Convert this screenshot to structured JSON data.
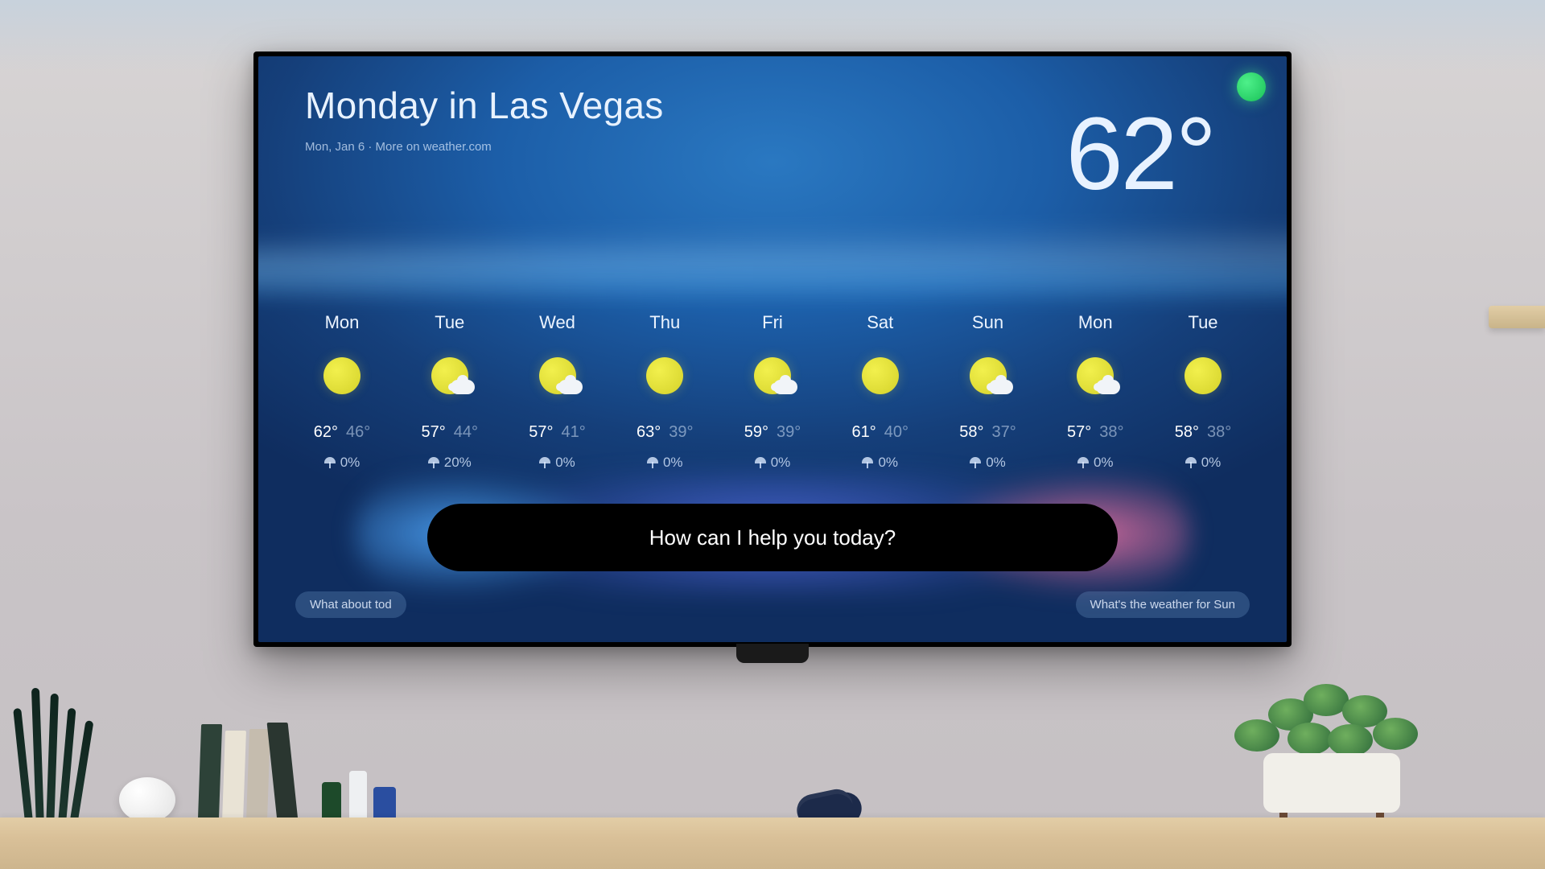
{
  "header": {
    "title": "Monday in Las Vegas",
    "subtitle": "Mon, Jan 6 · More on weather.com",
    "current_temp": "62°"
  },
  "assistant": {
    "prompt": "How can I help you today?",
    "suggestion_left": "What about tod",
    "suggestion_right": "What's the weather for Sun"
  },
  "forecast": [
    {
      "day": "Mon",
      "condition": "sunny",
      "hi": "62°",
      "lo": "46°",
      "precip": "0%"
    },
    {
      "day": "Tue",
      "condition": "partly-cloudy",
      "hi": "57°",
      "lo": "44°",
      "precip": "20%"
    },
    {
      "day": "Wed",
      "condition": "partly-cloudy",
      "hi": "57°",
      "lo": "41°",
      "precip": "0%"
    },
    {
      "day": "Thu",
      "condition": "sunny",
      "hi": "63°",
      "lo": "39°",
      "precip": "0%"
    },
    {
      "day": "Fri",
      "condition": "partly-cloudy",
      "hi": "59°",
      "lo": "39°",
      "precip": "0%"
    },
    {
      "day": "Sat",
      "condition": "sunny",
      "hi": "61°",
      "lo": "40°",
      "precip": "0%"
    },
    {
      "day": "Sun",
      "condition": "partly-cloudy",
      "hi": "58°",
      "lo": "37°",
      "precip": "0%"
    },
    {
      "day": "Mon",
      "condition": "partly-cloudy",
      "hi": "57°",
      "lo": "38°",
      "precip": "0%"
    },
    {
      "day": "Tue",
      "condition": "sunny",
      "hi": "58°",
      "lo": "38°",
      "precip": "0%"
    }
  ]
}
